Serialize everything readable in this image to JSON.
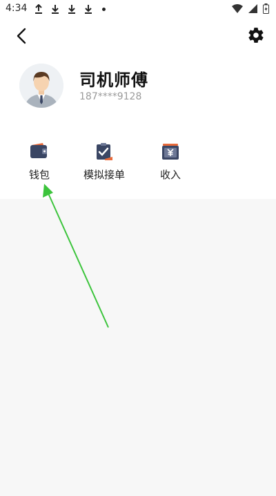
{
  "status_bar": {
    "time": "4:34"
  },
  "header": {},
  "profile": {
    "name": "司机师傅",
    "phone": "187****9128"
  },
  "shortcuts": [
    {
      "label": "钱包",
      "icon": "wallet-icon"
    },
    {
      "label": "模拟接单",
      "icon": "clipboard-check-icon"
    },
    {
      "label": "收入",
      "icon": "yuan-box-icon"
    }
  ],
  "colors": {
    "accent_dark": "#3a4664",
    "accent_orange": "#e86a3a",
    "arrow": "#3cc43c"
  }
}
